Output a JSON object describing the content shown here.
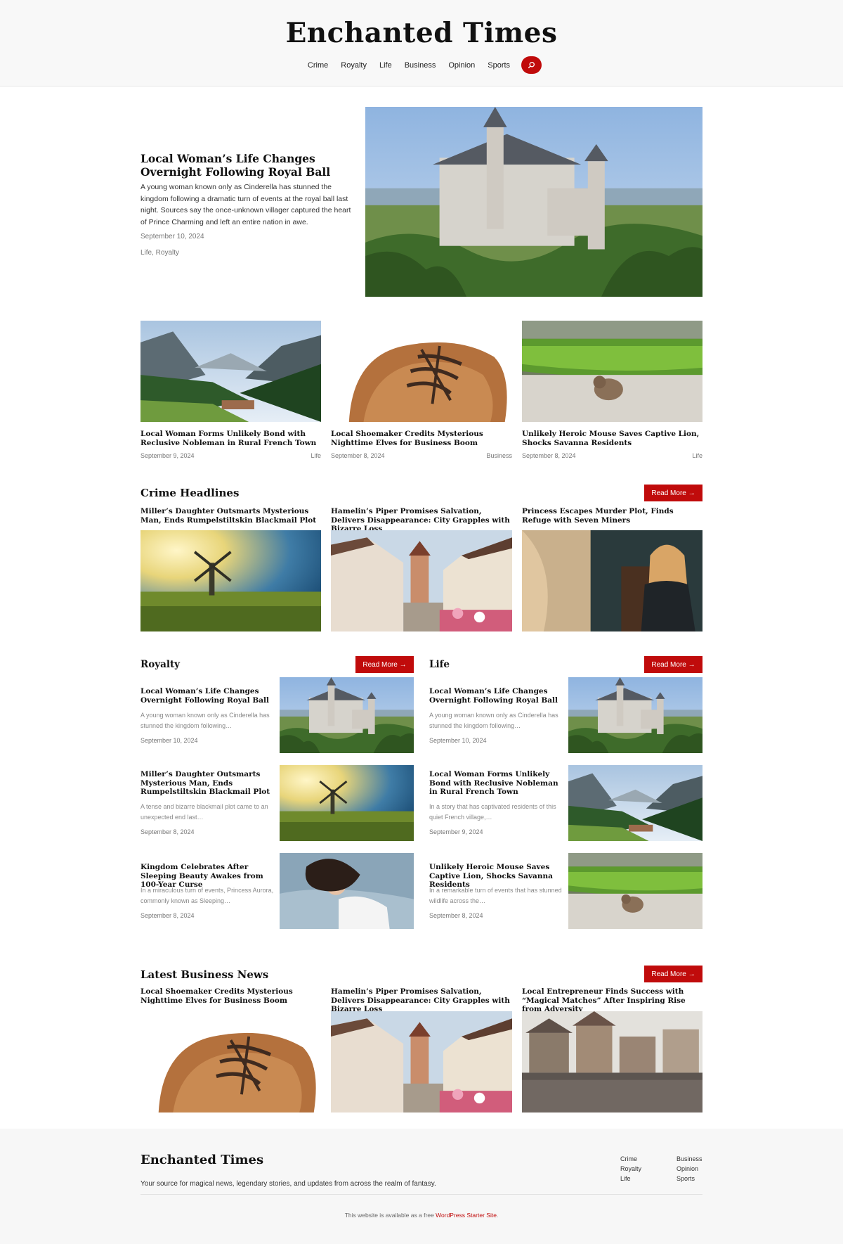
{
  "site": {
    "name": "Enchanted Times"
  },
  "nav": [
    "Crime",
    "Royalty",
    "Life",
    "Business",
    "Opinion",
    "Sports"
  ],
  "hero": {
    "title": "Local Woman’s Life Changes Overnight Following Royal Ball",
    "excerpt": "A young woman known only as Cinderella has stunned the kingdom following a dramatic turn of events at the royal ball last night. Sources say the once-unknown villager captured the heart of Prince Charming and left an entire nation in awe.",
    "date": "September 10, 2024",
    "categories": "Life, Royalty",
    "image": "castle"
  },
  "featured": [
    {
      "title": "Local Woman Forms Unlikely Bond with Reclusive Nobleman in Rural French Town",
      "date": "September 9, 2024",
      "category": "Life",
      "image": "valley"
    },
    {
      "title": "Local Shoemaker Credits Mysterious Nighttime Elves for Business Boom",
      "date": "September 8, 2024",
      "category": "Business",
      "image": "shoe"
    },
    {
      "title": "Unlikely Heroic Mouse Saves Captive Lion, Shocks Savanna Residents",
      "date": "September 8, 2024",
      "category": "Life",
      "image": "mouse"
    }
  ],
  "crime": {
    "heading": "Crime Headlines",
    "button": "Read More →",
    "items": [
      {
        "title": "Miller’s Daughter Outsmarts Mysterious Man, Ends Rumpelstiltskin Blackmail Plot",
        "image": "windmill"
      },
      {
        "title": "Hamelin’s Piper Promises Salvation, Delivers Disappearance: City Grapples with Bizarre Loss",
        "image": "street"
      },
      {
        "title": "Princess Escapes Murder Plot, Finds Refuge with Seven Miners",
        "image": "woman"
      }
    ]
  },
  "royalty": {
    "heading": "Royalty",
    "button": "Read More →",
    "items": [
      {
        "title": "Local Woman’s Life Changes Overnight Following Royal Ball",
        "excerpt": "A young woman known only as Cinderella has stunned the kingdom following…",
        "date": "September 10, 2024",
        "image": "castle"
      },
      {
        "title": "Miller’s Daughter Outsmarts Mysterious Man, Ends Rumpelstiltskin Blackmail Plot",
        "excerpt": "A tense and bizarre blackmail plot came to an unexpected end last…",
        "date": "September 8, 2024",
        "image": "windmill"
      },
      {
        "title": "Kingdom Celebrates After Sleeping Beauty Awakes from 100-Year Curse",
        "excerpt": "In a miraculous turn of events, Princess Aurora, commonly known as Sleeping…",
        "date": "September 8, 2024",
        "image": "sleeping"
      }
    ]
  },
  "life": {
    "heading": "Life",
    "button": "Read More →",
    "items": [
      {
        "title": "Local Woman’s Life Changes Overnight Following Royal Ball",
        "excerpt": "A young woman known only as Cinderella has stunned the kingdom following…",
        "date": "September 10, 2024",
        "image": "castle"
      },
      {
        "title": "Local Woman Forms Unlikely Bond with Reclusive Nobleman in Rural French Town",
        "excerpt": "In a story that has captivated residents of this quiet French village,…",
        "date": "September 9, 2024",
        "image": "valley"
      },
      {
        "title": "Unlikely Heroic Mouse Saves Captive Lion, Shocks Savanna Residents",
        "excerpt": "In a remarkable turn of events that has stunned wildlife across the…",
        "date": "September 8, 2024",
        "image": "mouse"
      }
    ]
  },
  "business": {
    "heading": "Latest Business News",
    "button": "Read More →",
    "items": [
      {
        "title": "Local Shoemaker Credits Mysterious Nighttime Elves for Business Boom",
        "image": "shoe"
      },
      {
        "title": "Hamelin’s Piper Promises Salvation, Delivers Disappearance: City Grapples with Bizarre Loss",
        "image": "street"
      },
      {
        "title": "Local Entrepreneur Finds Success with “Magical Matches” After Inspiring Rise from Adversity",
        "image": "town"
      }
    ]
  },
  "footer": {
    "name": "Enchanted Times",
    "tagline": "Your source for magical news, legendary stories, and updates from across the realm of fantasy.",
    "links_col1": [
      "Crime",
      "Royalty",
      "Life"
    ],
    "links_col2": [
      "Business",
      "Opinion",
      "Sports"
    ],
    "credit_prefix": "This website is available as a free ",
    "credit_link": "WordPress Starter Site",
    "credit_suffix": "."
  },
  "colors": {
    "accent": "#c00b0b",
    "text": "#111111",
    "muted": "#777777",
    "header_bg": "#f8f8f8"
  }
}
